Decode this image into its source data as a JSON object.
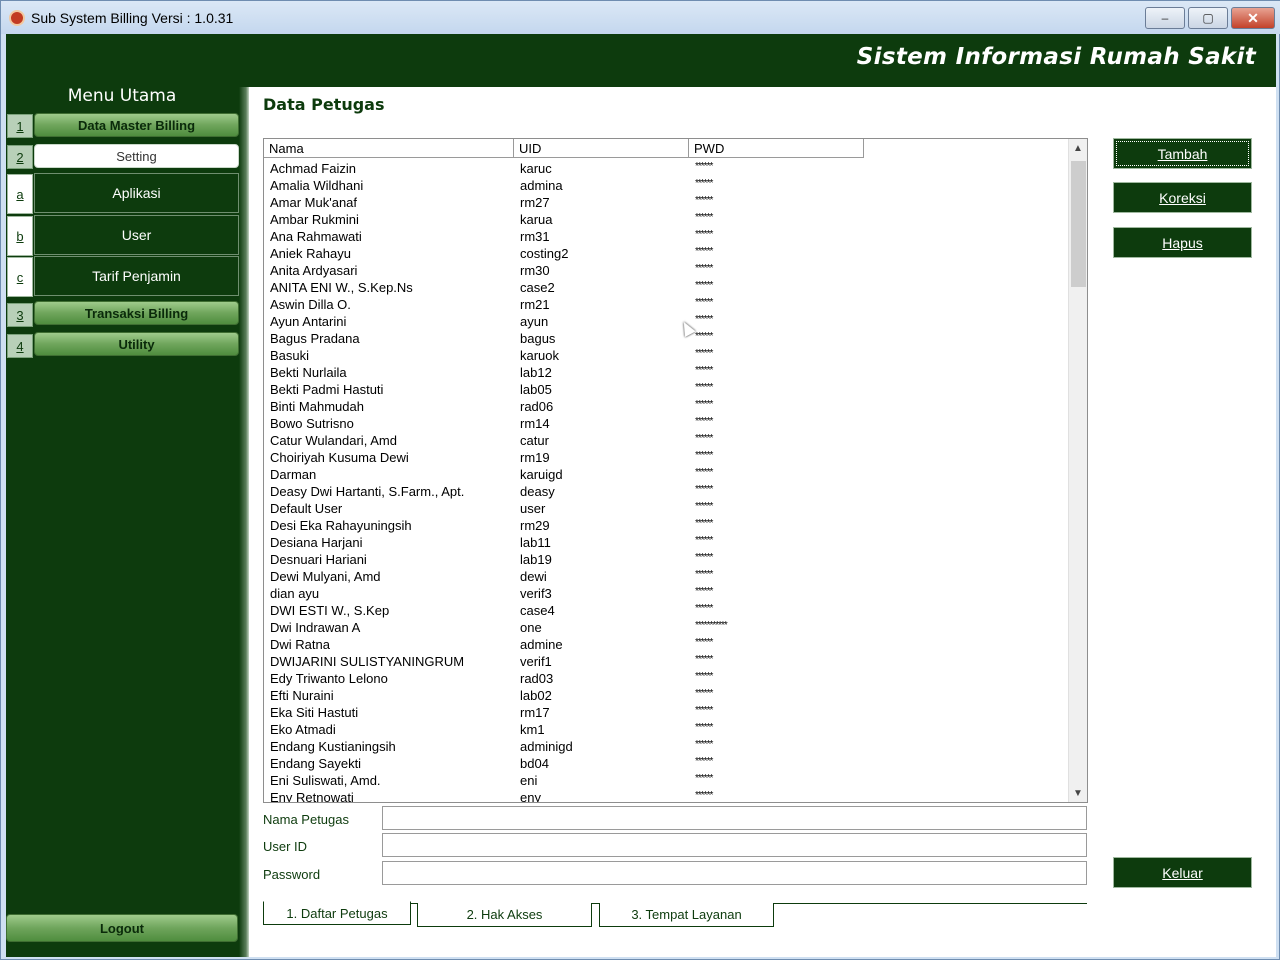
{
  "window": {
    "title": "Sub System Billing Versi : 1.0.31",
    "controls": {
      "minimize": "–",
      "maximize": "▢",
      "close": "✕"
    }
  },
  "header": {
    "title": "Sistem Informasi Rumah Sakit"
  },
  "sidebar": {
    "title": "Menu Utama",
    "groups": [
      {
        "num": "1",
        "label": "Data Master Billing"
      },
      {
        "num": "2",
        "label": "Setting"
      },
      {
        "num": "3",
        "label": "Transaksi Billing"
      },
      {
        "num": "4",
        "label": "Utility"
      }
    ],
    "sub_items": [
      {
        "key": "a",
        "label": "Aplikasi"
      },
      {
        "key": "b",
        "label": "User"
      },
      {
        "key": "c",
        "label": "Tarif Penjamin"
      }
    ],
    "logout": "Logout"
  },
  "main": {
    "title": "Data Petugas",
    "columns": [
      "Nama",
      "UID",
      "PWD"
    ],
    "rows": [
      [
        "Achmad Faizin",
        "karuc",
        "******"
      ],
      [
        "Amalia Wildhani",
        "admina",
        "******"
      ],
      [
        "Amar Muk'anaf",
        "rm27",
        "******"
      ],
      [
        "Ambar Rukmini",
        "karua",
        "******"
      ],
      [
        "Ana Rahmawati",
        "rm31",
        "******"
      ],
      [
        "Aniek Rahayu",
        "costing2",
        "******"
      ],
      [
        "Anita Ardyasari",
        "rm30",
        "******"
      ],
      [
        "ANITA ENI W., S.Kep.Ns",
        "case2",
        "******"
      ],
      [
        "Aswin Dilla O.",
        "rm21",
        "******"
      ],
      [
        "Ayun Antarini",
        "ayun",
        "******"
      ],
      [
        "Bagus Pradana",
        "bagus",
        "******"
      ],
      [
        "Basuki",
        "karuok",
        "******"
      ],
      [
        "Bekti Nurlaila",
        "lab12",
        "******"
      ],
      [
        "Bekti Padmi Hastuti",
        "lab05",
        "******"
      ],
      [
        "Binti Mahmudah",
        "rad06",
        "******"
      ],
      [
        "Bowo Sutrisno",
        "rm14",
        "******"
      ],
      [
        "Catur Wulandari, Amd",
        "catur",
        "******"
      ],
      [
        "Choiriyah Kusuma Dewi",
        "rm19",
        "******"
      ],
      [
        "Darman",
        "karuigd",
        "******"
      ],
      [
        "Deasy Dwi Hartanti, S.Farm., Apt.",
        "deasy",
        "******"
      ],
      [
        "Default User",
        "user",
        "******"
      ],
      [
        "Desi Eka Rahayuningsih",
        "rm29",
        "******"
      ],
      [
        "Desiana Harjani",
        "lab11",
        "******"
      ],
      [
        "Desnuari Hariani",
        "lab19",
        "******"
      ],
      [
        "Dewi Mulyani, Amd",
        "dewi",
        "******"
      ],
      [
        "dian ayu",
        "verif3",
        "******"
      ],
      [
        "DWI ESTI W., S.Kep",
        "case4",
        "******"
      ],
      [
        "Dwi Indrawan A",
        "one",
        "***********"
      ],
      [
        "Dwi Ratna",
        "admine",
        "******"
      ],
      [
        "DWIJARINI SULISTYANINGRUM",
        "verif1",
        "******"
      ],
      [
        "Edy Triwanto Lelono",
        "rad03",
        "******"
      ],
      [
        "Efti Nuraini",
        "lab02",
        "******"
      ],
      [
        "Eka Siti Hastuti",
        "rm17",
        "******"
      ],
      [
        "Eko Atmadi",
        "km1",
        "******"
      ],
      [
        "Endang Kustianingsih",
        "adminigd",
        "******"
      ],
      [
        "Endang Sayekti",
        "bd04",
        "******"
      ],
      [
        "Eni Suliswati, Amd.",
        "eni",
        "******"
      ],
      [
        "Eny Retnowati",
        "eny",
        "******"
      ]
    ],
    "form": {
      "nama_label": "Nama Petugas",
      "uid_label": "User ID",
      "pwd_label": "Password",
      "nama_value": "",
      "uid_value": "",
      "pwd_value": ""
    },
    "actions": {
      "tambah": "Tambah",
      "koreksi": "Koreksi",
      "hapus": "Hapus",
      "keluar": "Keluar"
    },
    "tabs": [
      "1. Daftar Petugas",
      "2. Hak Akses",
      "3. Tempat Layanan"
    ]
  }
}
